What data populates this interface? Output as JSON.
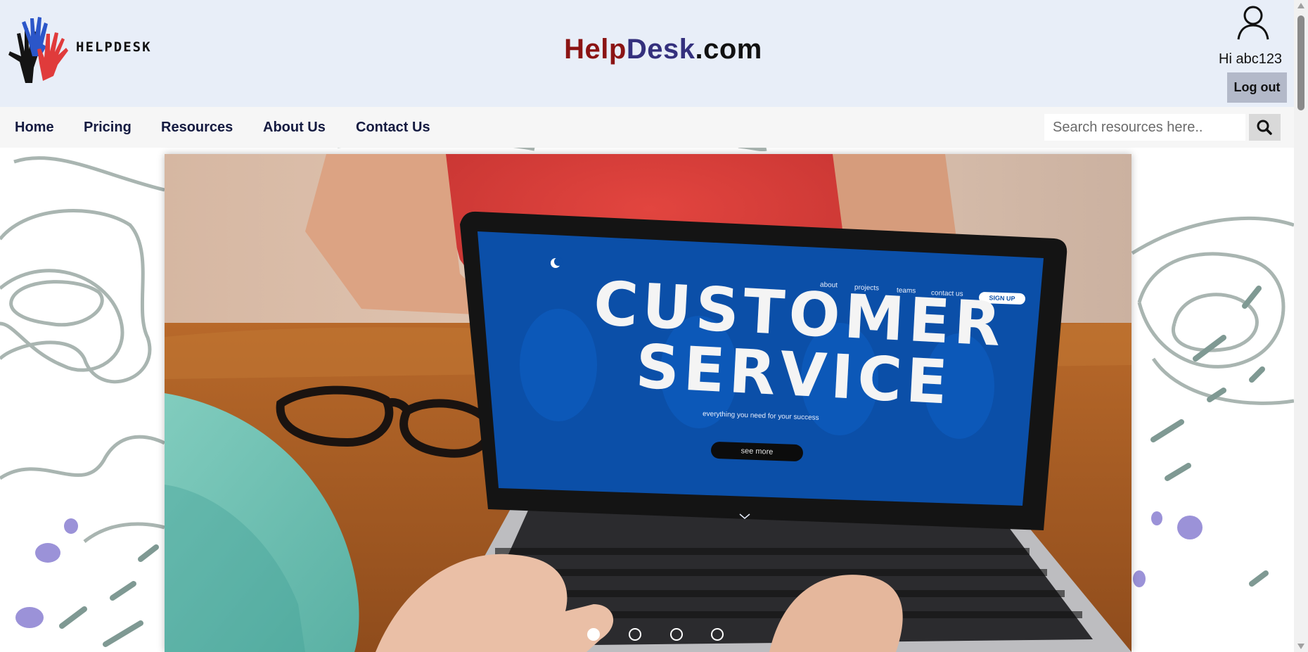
{
  "header": {
    "logo_text": "HELPDESK",
    "site_title": {
      "part1": "Help",
      "part2": "Desk",
      "part3": ".com"
    },
    "greeting": "Hi abc123",
    "logout_label": "Log out"
  },
  "nav": {
    "items": [
      {
        "label": "Home"
      },
      {
        "label": "Pricing"
      },
      {
        "label": "Resources"
      },
      {
        "label": "About Us"
      },
      {
        "label": "Contact Us"
      }
    ],
    "search": {
      "placeholder": "Search resources here.."
    }
  },
  "hero": {
    "screen": {
      "nav_links": [
        "about",
        "projects",
        "teams",
        "contact us"
      ],
      "signup_label": "SIGN UP",
      "headline_line1": "CUSTOMER",
      "headline_line2": "SERVICE",
      "tagline": "everything you need for your success",
      "cta_label": "see more"
    },
    "carousel": {
      "slide_count": 4,
      "active_index": 0
    }
  },
  "colors": {
    "header_bg": "#e8eef8",
    "title_help": "#8b1414",
    "title_desk": "#34307d",
    "nav_text": "#141a40",
    "screen_blue": "#0b4fa8",
    "logout_bg": "#b3b9c9"
  },
  "icons": {
    "logo": "hands-logo-icon",
    "user": "user-icon",
    "search": "search-icon",
    "screen_logo": "moon-logo-icon",
    "scroll": "chevron-down-icon"
  }
}
